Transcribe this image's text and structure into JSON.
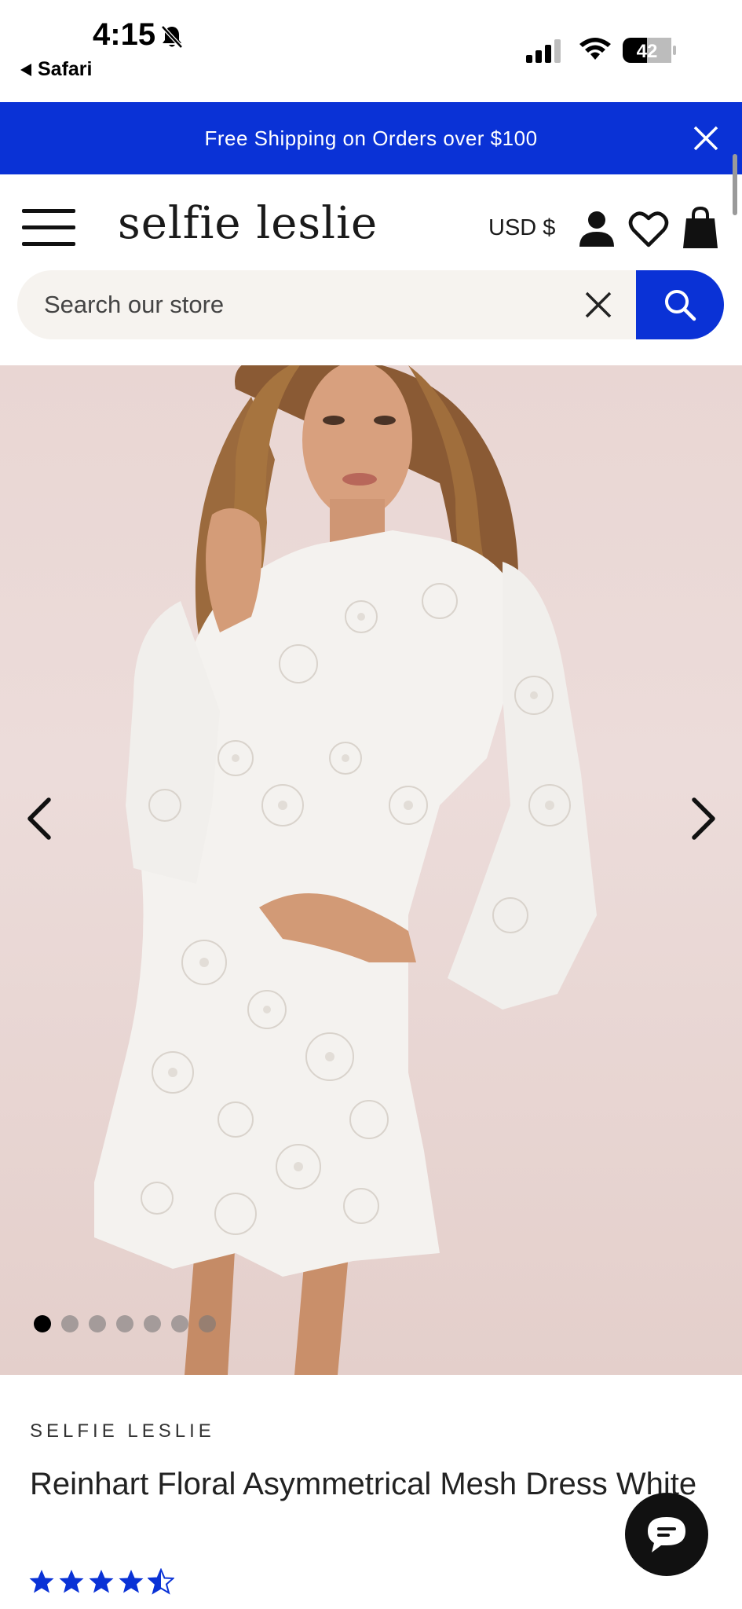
{
  "status_bar": {
    "time": "4:15",
    "back_app": "Safari",
    "battery": "42"
  },
  "promo": {
    "text": "Free Shipping on Orders over $100"
  },
  "header": {
    "logo": "selfie leslie",
    "currency": "USD $"
  },
  "search": {
    "placeholder": "Search our store"
  },
  "gallery": {
    "slide_count": 7,
    "active_slide": 1
  },
  "product": {
    "brand": "SELFIE LESLIE",
    "title": "Reinhart Floral Asymmetrical Mesh Dress White",
    "rating": 4.5
  },
  "colors": {
    "accent": "#0a32d6",
    "banner_bg": "#0a32d6",
    "search_bg": "#f6f3ef",
    "chat_bg": "#111111"
  },
  "icons": {
    "bell": "bell-slash-icon",
    "signal": "cellular-signal-icon",
    "wifi": "wifi-icon",
    "battery": "battery-icon",
    "close": "close-icon",
    "menu": "hamburger-menu-icon",
    "account": "account-icon",
    "wishlist": "heart-icon",
    "bag": "shopping-bag-icon",
    "search": "search-icon",
    "prev": "chevron-left-icon",
    "next": "chevron-right-icon",
    "chat": "chat-icon",
    "star": "star-icon"
  }
}
